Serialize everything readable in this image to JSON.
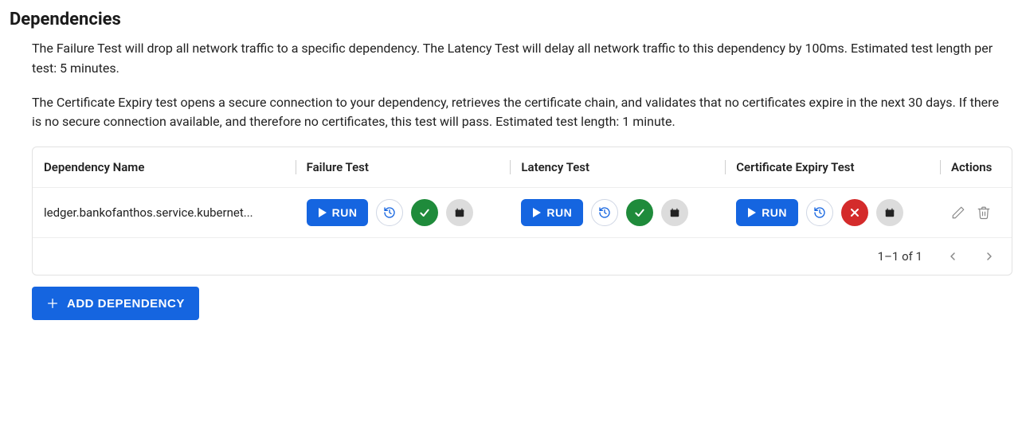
{
  "title": "Dependencies",
  "desc": {
    "p1": "The Failure Test will drop all network traffic to a specific dependency. The Latency Test will delay all network traffic to this dependency by 100ms. Estimated test length per test: 5 minutes.",
    "p2": "The Certificate Expiry test opens a secure connection to your dependency, retrieves the certificate chain, and validates that no certificates expire in the next 30 days. If there is no secure connection available, and therefore no certificates, this test will pass. Estimated test length: 1 minute."
  },
  "columns": {
    "name": "Dependency Name",
    "failure": "Failure Test",
    "latency": "Latency Test",
    "cert": "Certificate Expiry Test",
    "actions": "Actions"
  },
  "run_label": "RUN",
  "rows": [
    {
      "name": "ledger.bankofanthos.service.kubernet...",
      "failure_status": "pass",
      "latency_status": "pass",
      "cert_status": "fail"
    }
  ],
  "pager": {
    "text": "1–1 of 1"
  },
  "add_label": "ADD DEPENDENCY"
}
